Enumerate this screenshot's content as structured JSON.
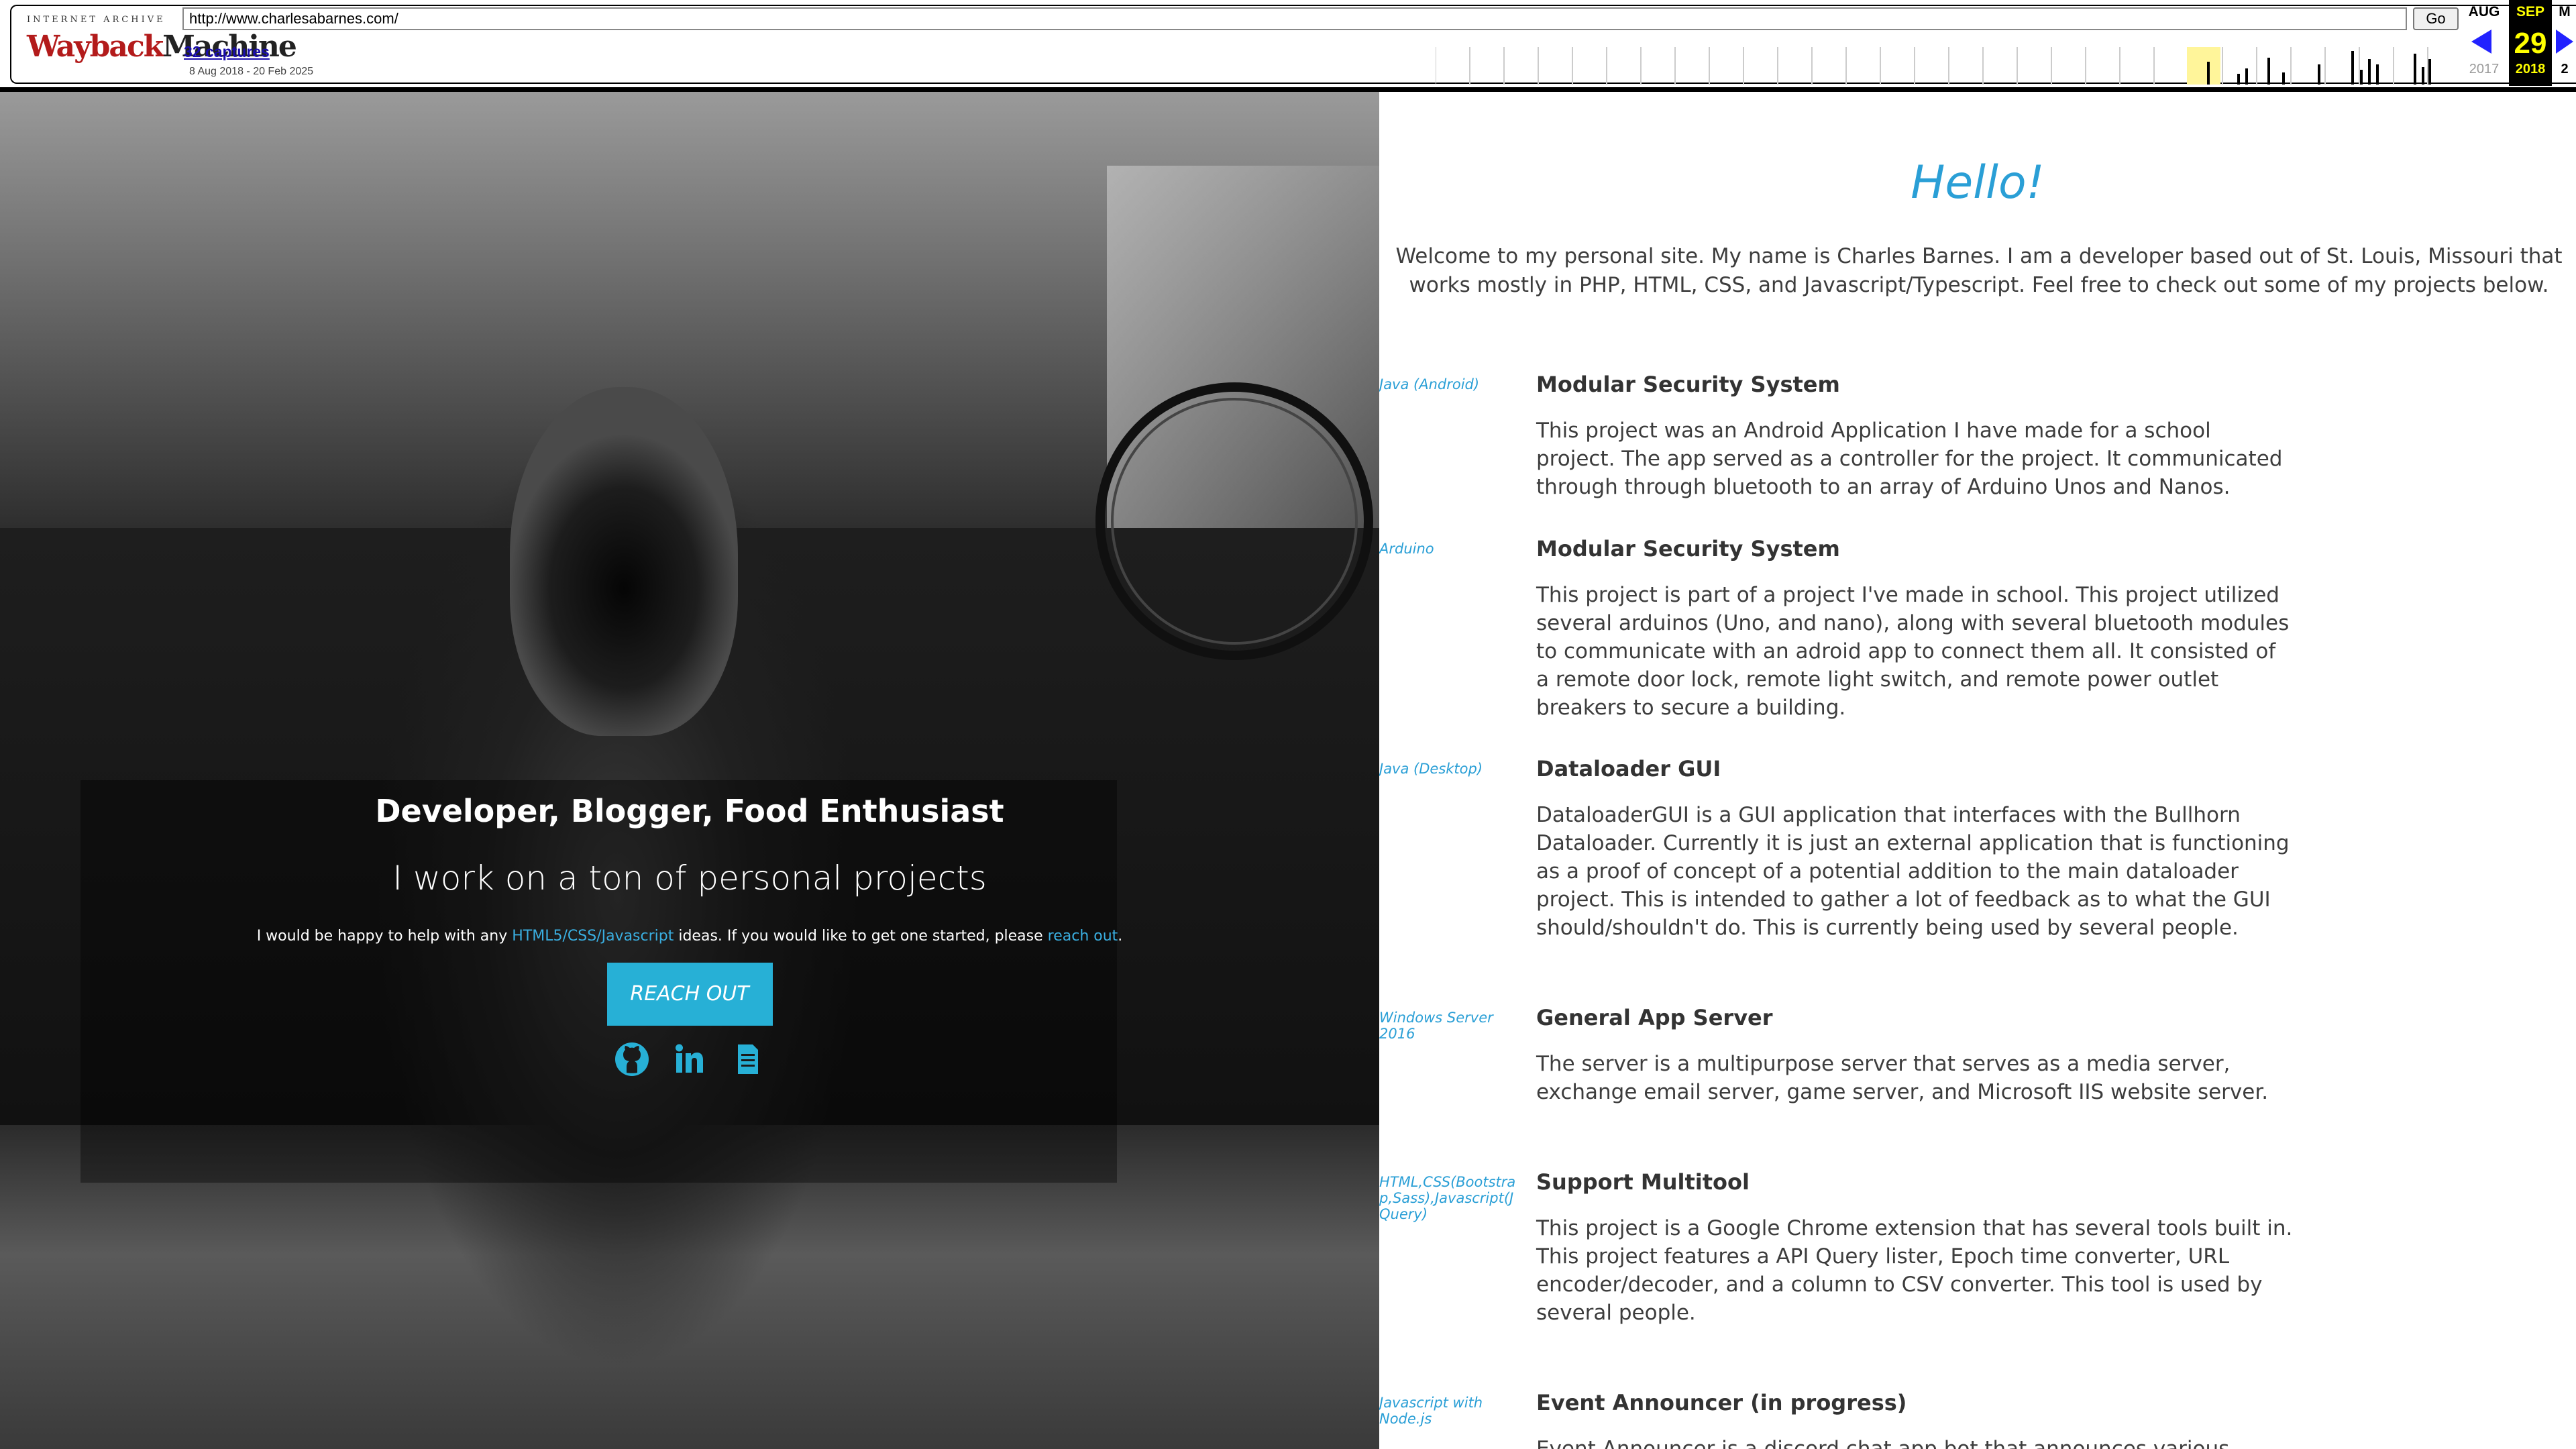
{
  "wayback": {
    "url": "http://www.charlesabarnes.com/",
    "go_label": "Go",
    "captures": "32 captures",
    "date_range": "8 Aug 2018 - 20 Feb 2025",
    "logo_top": "INTERNET ARCHIVE",
    "logo_wayback": "Wayback",
    "logo_machine": "Machine",
    "prev": {
      "month": "AUG",
      "year": "2017"
    },
    "current": {
      "month": "SEP",
      "day": "29",
      "year": "2018"
    },
    "next": {
      "month": "M",
      "year": "2"
    }
  },
  "hero": {
    "heading": "Developer, Blogger, Food Enthusiast",
    "subheading": "I work on a ton of personal projects",
    "blurb_start": "I would be happy to help with any ",
    "blurb_link1": "HTML5/CSS/Javascript",
    "blurb_mid": " ideas. If you would like to get one started, please ",
    "blurb_link2": "reach out",
    "blurb_end": ".",
    "button": "REACH OUT",
    "social_icons": [
      "github-icon",
      "linkedin-icon",
      "document-icon"
    ],
    "link_color": "#3aaee0",
    "button_color": "#27b0d6"
  },
  "main": {
    "hello": "Hello!",
    "intro": "Welcome to my personal site. My name is Charles Barnes. I am a developer based out of St. Louis, Missouri that works mostly in PHP, HTML, CSS, and Javascript/Typescript. Feel free to check out some of my projects below.",
    "accent_color": "#2a9fd6",
    "projects": [
      {
        "tech": "Java (Android)",
        "title": "Modular Security System",
        "desc": "This project was an Android Application I have made for a school project. The app served as a controller for the project. It communicated through through bluetooth to an array of Arduino Unos and Nanos."
      },
      {
        "tech": "Arduino",
        "title": "Modular Security System",
        "desc": "This project is part of a project I've made in school. This project utilized several arduinos (Uno, and nano), along with several bluetooth modules to communicate with an adroid app to connect them all. It consisted of a remote door lock, remote light switch, and remote power outlet breakers to secure a building."
      },
      {
        "tech": "Java (Desktop)",
        "title": "Dataloader GUI",
        "desc": "DataloaderGUI is a GUI application that interfaces with the Bullhorn Dataloader. Currently it is just an external application that is functioning as a proof of concept of a potential addition to the main dataloader project. This is intended to gather a lot of feedback as to what the GUI should/shouldn't do. This is currently being used by several people."
      },
      {
        "tech": "Windows Server 2016",
        "title": "General App Server",
        "desc": "The server is a multipurpose server that serves as a media server, exchange email server, game server, and Microsoft IIS website server."
      },
      {
        "tech": "HTML,CSS(Bootstrap,Sass),Javascript(JQuery)",
        "title": "Support Multitool",
        "desc": "This project is a Google Chrome extension that has several tools built in. This project features a API Query lister, Epoch time converter, URL encoder/decoder, and a column to CSV converter. This tool is used by several people."
      },
      {
        "tech": "Javascript with Node.js",
        "title": "Event Announcer (in progress)",
        "desc": "Event Announcer is a discord chat app bot that announces various events"
      }
    ]
  }
}
